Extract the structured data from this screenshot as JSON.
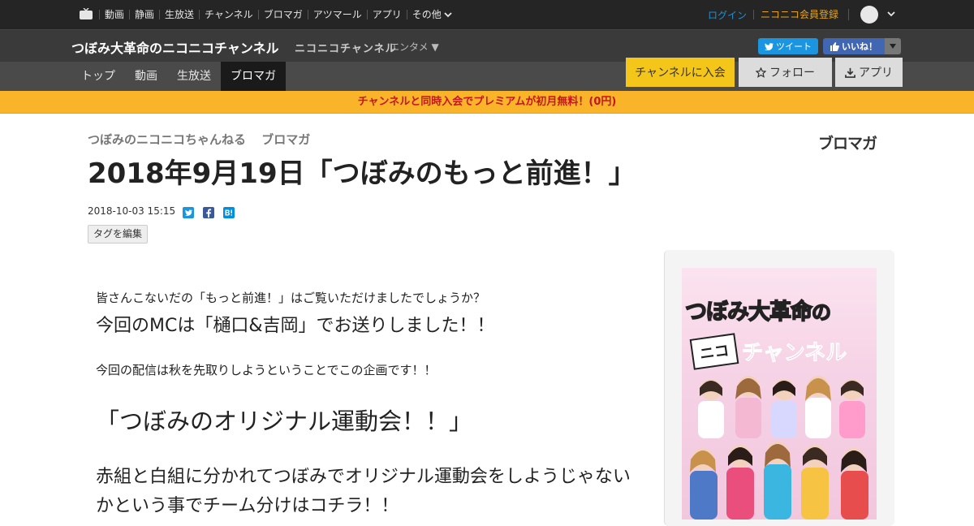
{
  "global_nav": {
    "items": [
      "動画",
      "静画",
      "生放送",
      "チャンネル",
      "ブロマガ",
      "アツマール",
      "アプリ"
    ],
    "more_label": "その他",
    "login_label": "ログイン",
    "register_label": "ニコニコ会員登録"
  },
  "channel": {
    "title": "つぼみ大革命のニコニコチャンネル",
    "brand": "ニコニコチャンネル",
    "category": "エンタメ ▼",
    "tweet_label": "ツイート",
    "like_label": "いいね！"
  },
  "tabs": {
    "items": [
      "トップ",
      "動画",
      "生放送",
      "ブロマガ"
    ],
    "active_index": 3,
    "join_label": "チャンネルに入会",
    "follow_label": "フォロー",
    "app_label": "アプリ"
  },
  "banner": {
    "text": "チャンネルと同時入会でプレミアムが初月無料！(0円)"
  },
  "article": {
    "breadcrumb_channel": "つぼみのニコニコちゃんねる",
    "breadcrumb_section": "ブロマガ",
    "logo": "ブロマガ",
    "title": "2018年9月19日「つぼみのもっと前進！」",
    "datetime": "2018-10-03 15:15",
    "tag_edit_label": "タグを編集",
    "paragraphs": [
      "皆さんこないだの「もっと前進！」はご覧いただけましたでしょうか？",
      "今回のMCは「樋口&吉岡」でお送りしました！！",
      "今回の配信は秋を先取りしようということでこの企画です！！",
      "「つぼみのオリジナル運動会！！」",
      "赤組と白組に分かれてつぼみでオリジナル運動会をしようじゃないかという事でチーム分けはコチラ！！"
    ]
  },
  "sidebar": {
    "poster_title": "つぼみ大革命",
    "poster_no": "の",
    "poster_nico": "ニコ",
    "poster_channel": "チャンネル"
  },
  "colors": {
    "join": "#f5c61a",
    "banner": "#f9b42a",
    "banner_text": "#c8141e",
    "login": "#1e90d6",
    "register": "#e8a31d"
  }
}
